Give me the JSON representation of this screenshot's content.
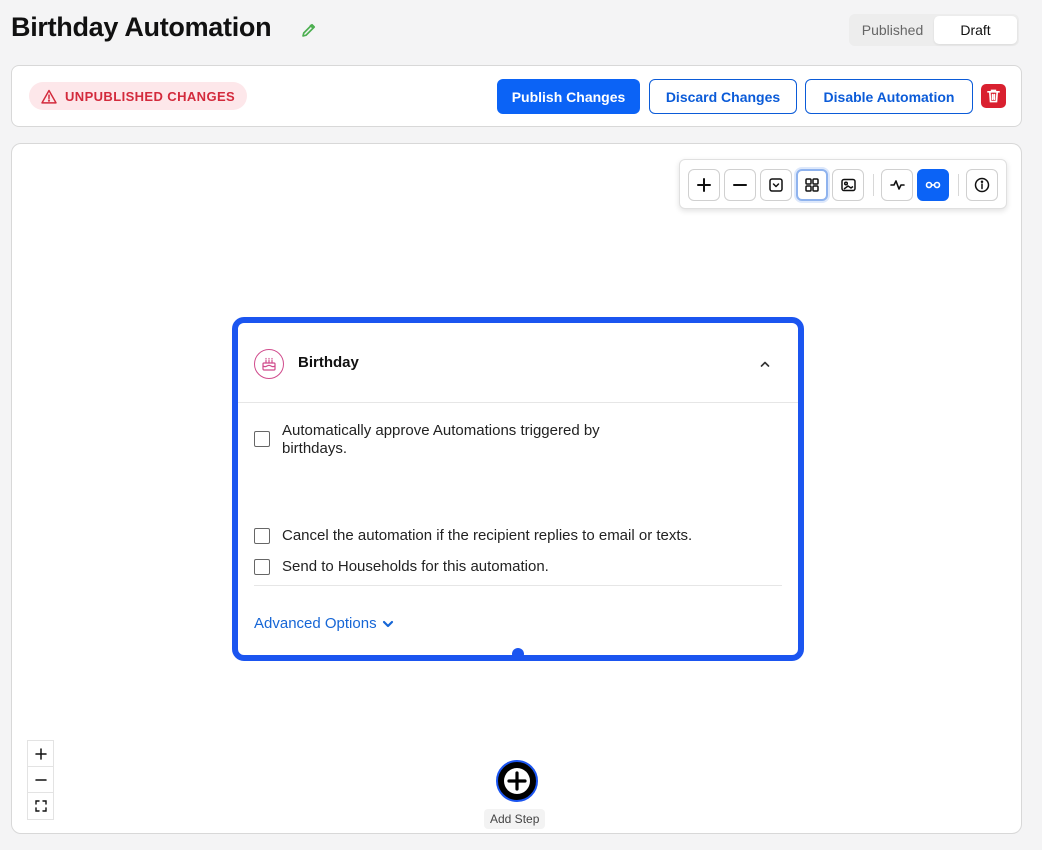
{
  "header": {
    "title": "Birthday Automation",
    "status_tabs": [
      {
        "label": "Published",
        "active": false
      },
      {
        "label": "Draft",
        "active": true
      }
    ]
  },
  "action_bar": {
    "badge": "UNPUBLISHED CHANGES",
    "publish_label": "Publish Changes",
    "discard_label": "Discard Changes",
    "disable_label": "Disable Automation"
  },
  "card": {
    "title": "Birthday",
    "options": [
      {
        "label": "Automatically approve Automations triggered by birthdays.",
        "checked": false
      },
      {
        "label": "Cancel the automation if the recipient replies to email or texts.",
        "checked": false
      },
      {
        "label": "Send to Households for this automation.",
        "checked": false
      }
    ],
    "advanced_label": "Advanced Options"
  },
  "add_step": {
    "label": "Add Step"
  },
  "colors": {
    "primary": "#0b63f6",
    "card_border": "#1b55f0",
    "danger": "#d9202f",
    "badge_bg": "#fde7ea",
    "link": "#1666d6"
  }
}
